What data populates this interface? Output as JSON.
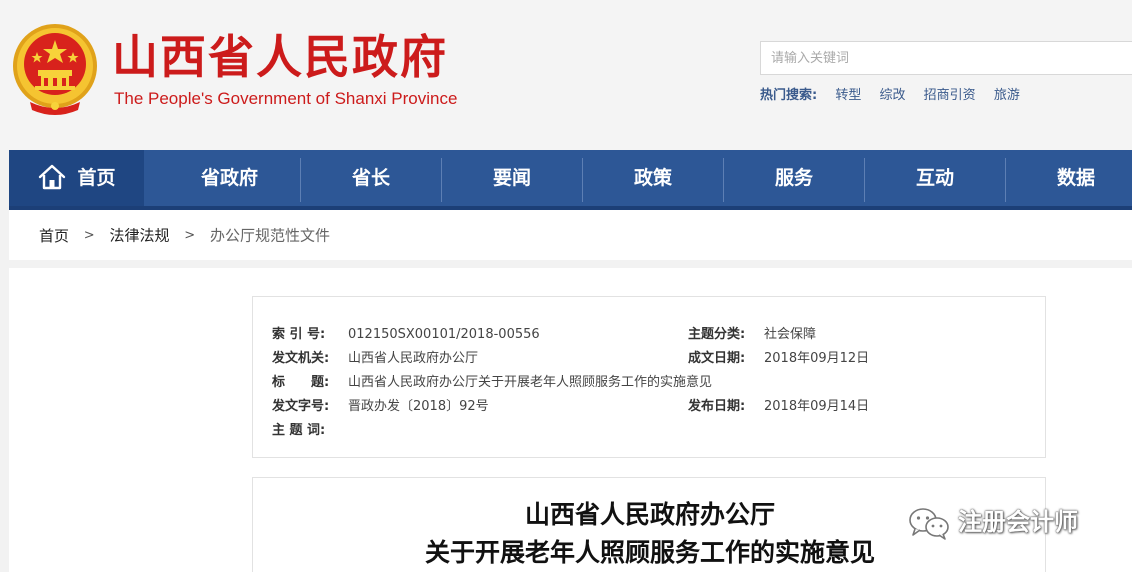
{
  "header": {
    "title": "山西省人民政府",
    "subtitle": "The People's Government of Shanxi Province",
    "search_placeholder": "请输入关键词",
    "hot_label": "热门搜索:",
    "hot_items": [
      "转型",
      "综改",
      "招商引资",
      "旅游"
    ],
    "brand_color": "#cc1b1b"
  },
  "nav": {
    "items": [
      "首页",
      "省政府",
      "省长",
      "要闻",
      "政策",
      "服务",
      "互动",
      "数据"
    ],
    "color": "#2d5796"
  },
  "breadcrumb": {
    "home": "首页",
    "sep": ">",
    "section": "法律法规",
    "current": "办公厅规范性文件"
  },
  "meta": {
    "index_label": "索 引 号:",
    "index_value": "012150SX00101/2018-00556",
    "topic_label": "主题分类:",
    "topic_value": "社会保障",
    "issuer_label": "发文机关:",
    "issuer_value": "山西省人民政府办公厅",
    "written_label": "成文日期:",
    "written_value": "2018年09月12日",
    "title_label": "标　　题:",
    "title_value": "山西省人民政府办公厅关于开展老年人照顾服务工作的实施意见",
    "docno_label": "发文字号:",
    "docno_value": "晋政办发〔2018〕92号",
    "published_label": "发布日期:",
    "published_value": "2018年09月14日",
    "keywords_label": "主 题 词:"
  },
  "document": {
    "title_line1": "山西省人民政府办公厅",
    "title_line2": "关于开展老年人照顾服务工作的实施意见"
  },
  "watermark": {
    "text": "注册会计师",
    "icon": "wechat-icon"
  }
}
